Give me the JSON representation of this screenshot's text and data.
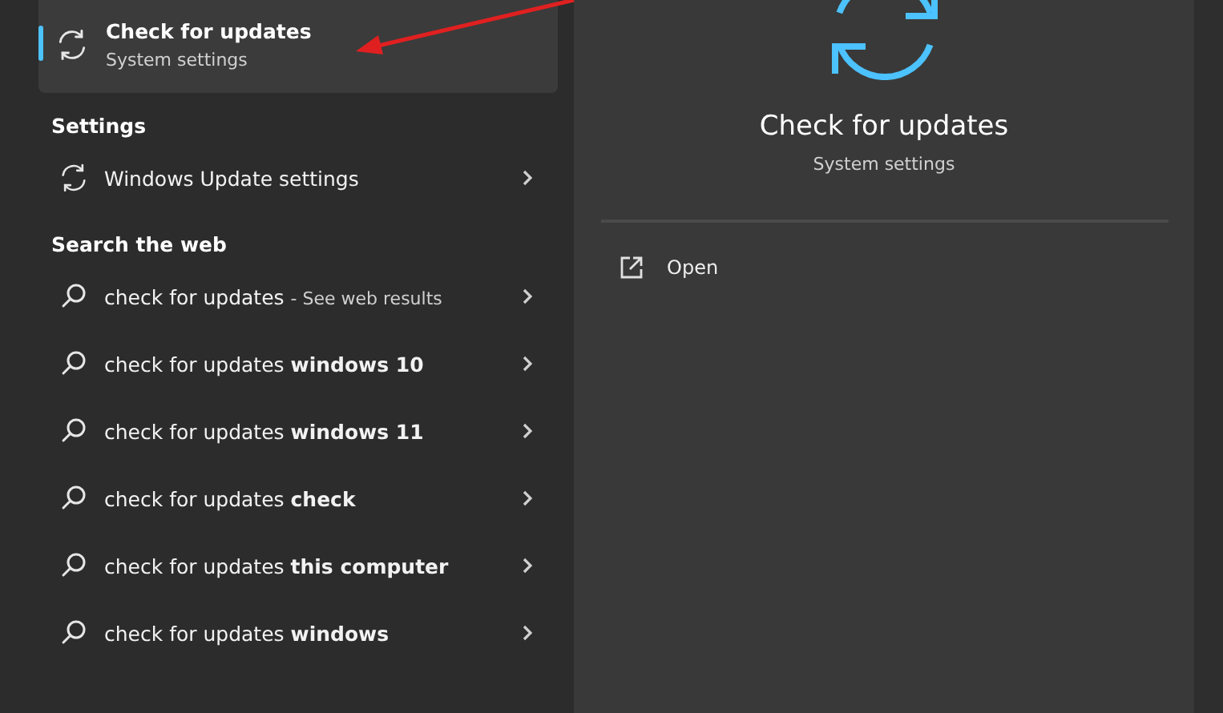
{
  "best_match": {
    "title": "Check for updates",
    "subtitle": "System settings",
    "selected": true
  },
  "sections": [
    {
      "heading": "Settings",
      "items": [
        {
          "kind": "setting",
          "text": "Windows Update settings"
        }
      ]
    },
    {
      "heading": "Search the web",
      "items": [
        {
          "kind": "web",
          "text": "check for updates",
          "hint": "- See web results"
        },
        {
          "kind": "web",
          "text": "check for updates **windows 10**"
        },
        {
          "kind": "web",
          "text": "check for updates **windows 11**"
        },
        {
          "kind": "web",
          "text": "check for updates **check**"
        },
        {
          "kind": "web",
          "text": "check for updates **this computer**"
        },
        {
          "kind": "web",
          "text": "check for updates **windows**"
        }
      ]
    }
  ],
  "detail": {
    "title": "Check for updates",
    "subtitle": "System settings",
    "actions": [
      {
        "label": "Open"
      }
    ]
  }
}
